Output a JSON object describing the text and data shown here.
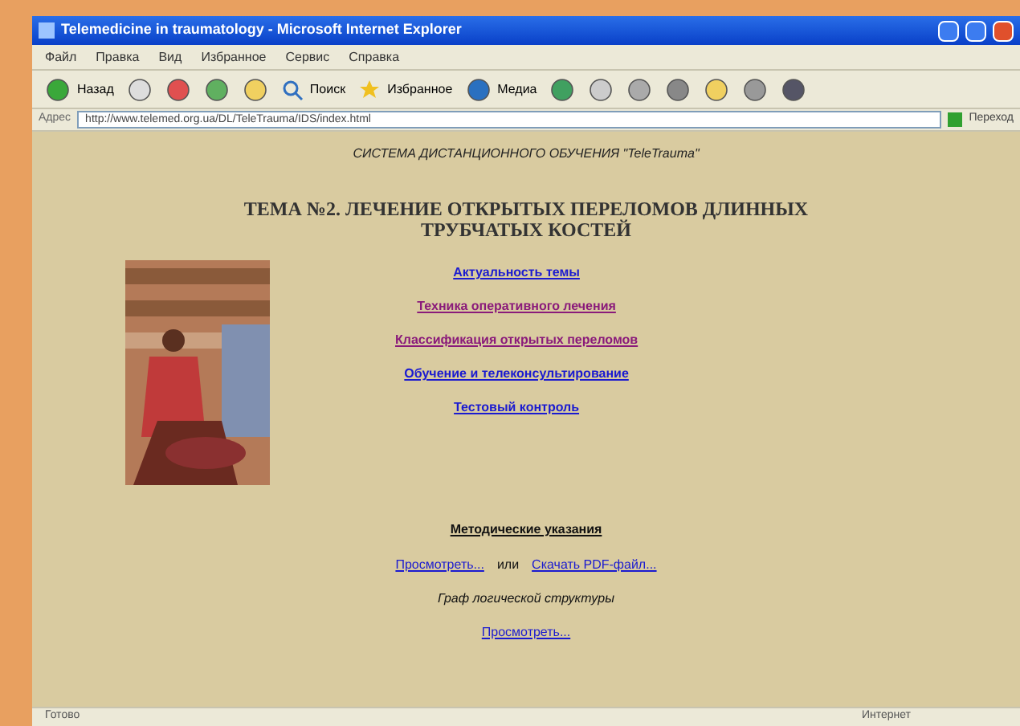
{
  "window": {
    "title": "Telemedicine in traumatology - Microsoft Internet Explorer"
  },
  "menu": [
    "Файл",
    "Правка",
    "Вид",
    "Избранное",
    "Сервис",
    "Справка"
  ],
  "toolbar": {
    "back": "Назад",
    "search": "Поиск",
    "favorites": "Избранное",
    "media": "Медиа"
  },
  "address_bar": {
    "label": "Адрес",
    "value": "http://www.telemed.org.ua/DL/TeleTrauma/IDS/index.html",
    "go": "Переход"
  },
  "page": {
    "system": "СИСТЕМА ДИСТАНЦИОННОГО ОБУЧЕНИЯ \"TeleTrauma\"",
    "heading": "ТЕМА №2. ЛЕЧЕНИЕ ОТКРЫТЫХ  ПЕРЕЛОМОВ ДЛИННЫХ ТРУБЧАТЫХ КОСТЕЙ",
    "links": [
      {
        "text": "Актуальность темы",
        "visited": false
      },
      {
        "text": "Техника оперативного лечения",
        "visited": true
      },
      {
        "text": "Классификация открытых переломов",
        "visited": true
      },
      {
        "text": "Обучение и телеконсультирование",
        "visited": false
      },
      {
        "text": "Тестовый контроль",
        "visited": false
      }
    ],
    "guide_title": "Методические указания",
    "view_link": "Просмотреть...",
    "or": "или",
    "pdf_link": "Скачать PDF-файл...",
    "graph_title": "Граф логической структуры",
    "graph_link": "Просмотреть..."
  },
  "status_bar": {
    "status": "Готово",
    "zone": "Интернет"
  }
}
